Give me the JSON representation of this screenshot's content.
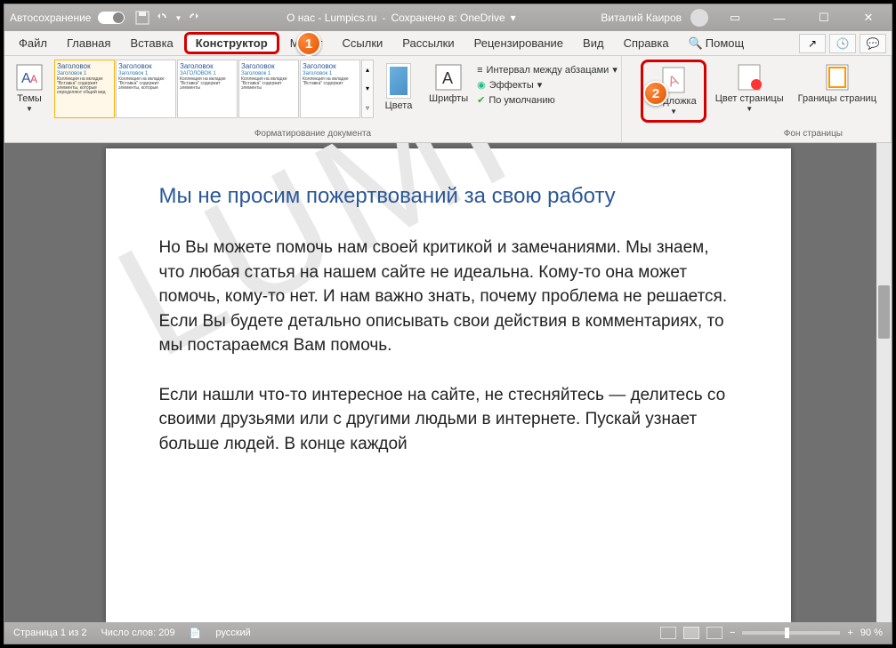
{
  "titlebar": {
    "autosave": "Автосохранение",
    "doc": "О нас - Lumpics.ru",
    "saved": "Сохранено в: OneDrive",
    "user": "Виталий Каиров"
  },
  "tabs": {
    "file": "Файл",
    "home": "Главная",
    "insert": "Вставка",
    "design": "Конструктор",
    "layout": "Макет",
    "references": "Ссылки",
    "mailings": "Рассылки",
    "review": "Рецензирование",
    "view": "Вид",
    "help": "Справка",
    "tell": "Помощ"
  },
  "ribbon": {
    "themes": "Темы",
    "gallery": [
      {
        "h": "Заголовок",
        "sh": "Заголовок 1",
        "t": "Коллекция на вкладке \"Вставка\" содержит элементы, которые определяют общий вид"
      },
      {
        "h": "Заголовок",
        "sh": "Заголовок 1",
        "t": "Коллекция на вкладке \"Вставка\" содержит элементы, которые"
      },
      {
        "h": "Заголовок",
        "sh": "ЗАГОЛОВОК 1",
        "t": "Коллекция на вкладке \"Вставка\" содержит элементы"
      },
      {
        "h": "Заголовок",
        "sh": "Заголовок 1",
        "t": "Коллекция на вкладке \"Вставка\" содержит элементы"
      },
      {
        "h": "Заголовок",
        "sh": "Заголовок 1",
        "t": "Коллекция на вкладке \"Вставка\" содержит"
      }
    ],
    "colors": "Цвета",
    "fonts": "Шрифты",
    "spacing": "Интервал между абзацами",
    "effects": "Эффекты",
    "default": "По умолчанию",
    "fmt_group": "Форматирование документа",
    "watermark": "Подложка",
    "pagecolor": "Цвет страницы",
    "borders": "Границы страниц",
    "bg_group": "Фон страницы"
  },
  "badges": {
    "b1": "1",
    "b2": "2"
  },
  "doc": {
    "wm": "LUMPI",
    "h": "Мы не просим пожертвований за свою работу",
    "p1": "Но Вы можете помочь нам своей критикой и замечаниями. Мы знаем, что любая статья на нашем сайте не идеальна. Кому-то она может помочь, кому-то нет. И нам важно знать, почему проблема не решается. Если Вы будете детально описывать свои действия в комментариях, то мы постараемся Вам помочь.",
    "p2": "Если нашли что-то интересное на сайте, не стесняйтесь — делитесь со своими друзьями или с другими людьми в интернете. Пускай узнает больше людей. В конце каждой"
  },
  "status": {
    "page": "Страница 1 из 2",
    "words": "Число слов: 209",
    "lang": "русский",
    "zoom": "90 %"
  }
}
